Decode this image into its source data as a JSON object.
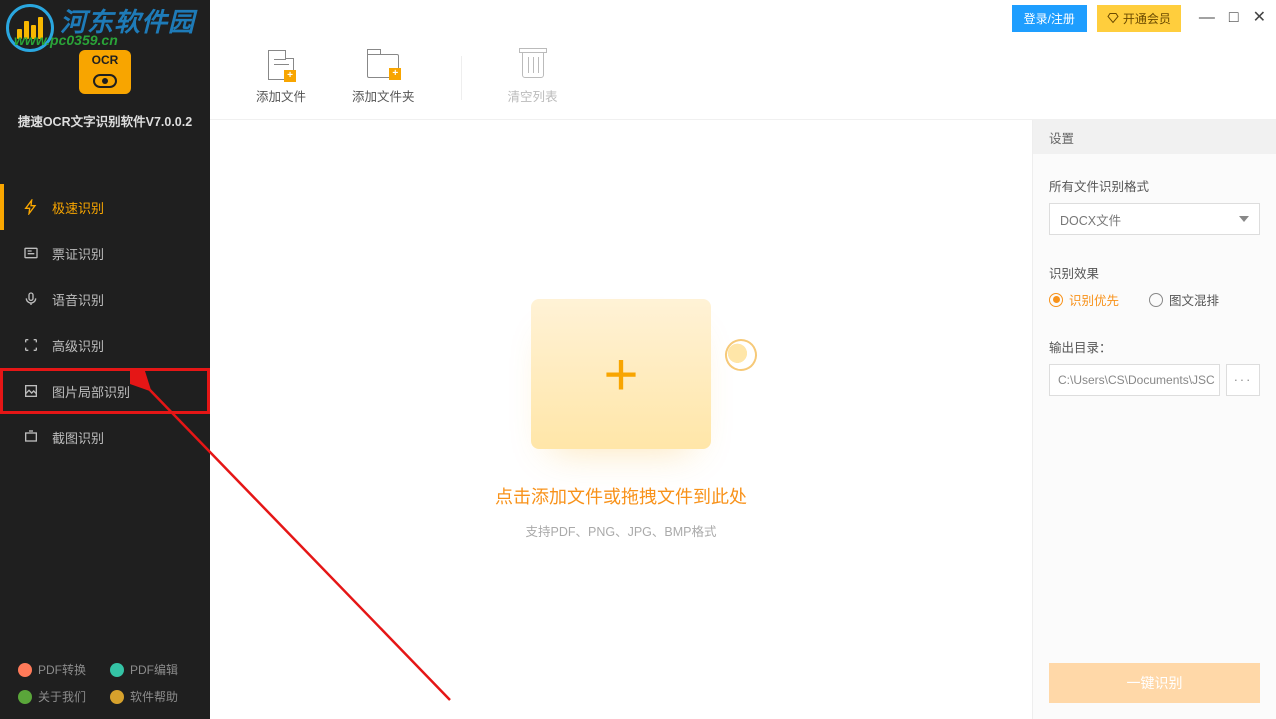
{
  "watermark": {
    "brand": "河东软件园",
    "url": "www.pc0359.cn"
  },
  "app": {
    "version_line": "捷速OCR文字识别软件V7.0.0.2"
  },
  "titlebar": {
    "login": "登录/注册",
    "vip": "开通会员"
  },
  "sidebar": {
    "items": [
      {
        "label": "极速识别"
      },
      {
        "label": "票证识别"
      },
      {
        "label": "语音识别"
      },
      {
        "label": "高级识别"
      },
      {
        "label": "图片局部识别"
      },
      {
        "label": "截图识别"
      }
    ],
    "footer": {
      "pdf_convert": "PDF转换",
      "pdf_edit": "PDF编辑",
      "about": "关于我们",
      "help": "软件帮助"
    }
  },
  "toolbar": {
    "add_file": "添加文件",
    "add_folder": "添加文件夹",
    "clear_list": "清空列表"
  },
  "drop": {
    "title": "点击添加文件或拖拽文件到此处",
    "subtitle": "支持PDF、PNG、JPG、BMP格式"
  },
  "panel": {
    "header": "设置",
    "format_label": "所有文件识别格式",
    "format_value": "DOCX文件",
    "effect_label": "识别效果",
    "radio_priority": "识别优先",
    "radio_mixed": "图文混排",
    "output_label": "输出目录：",
    "output_path": "C:\\Users\\CS\\Documents\\JSC",
    "browse": "···",
    "run": "一键识别"
  }
}
